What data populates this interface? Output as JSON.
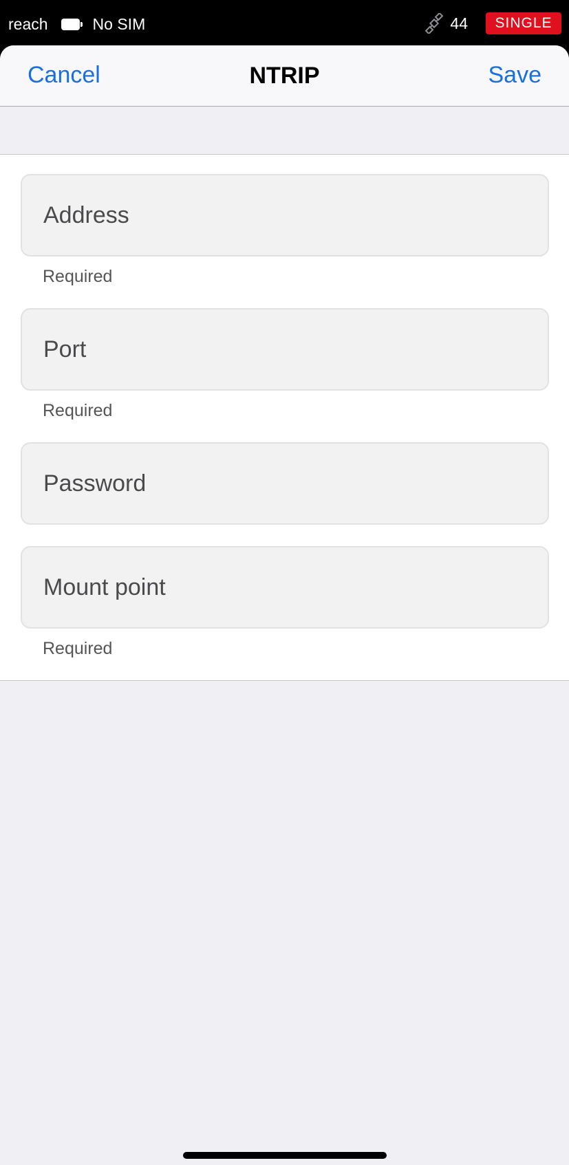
{
  "status_bar": {
    "app_name": "reach",
    "battery_icon": "battery-icon",
    "carrier": "No SIM",
    "satellite_icon": "satellite-icon",
    "satellite_count": "44",
    "solution_status": "SINGLE",
    "solution_color": "#e0101e"
  },
  "nav": {
    "cancel_label": "Cancel",
    "title": "NTRIP",
    "save_label": "Save",
    "accent_color": "#1a6fe0"
  },
  "form": {
    "fields": [
      {
        "placeholder": "Address",
        "value": "",
        "helper": "Required"
      },
      {
        "placeholder": "Port",
        "value": "",
        "helper": "Required"
      },
      {
        "placeholder": "Password",
        "value": "",
        "helper": ""
      },
      {
        "placeholder": "Mount point",
        "value": "",
        "helper": "Required"
      }
    ]
  }
}
